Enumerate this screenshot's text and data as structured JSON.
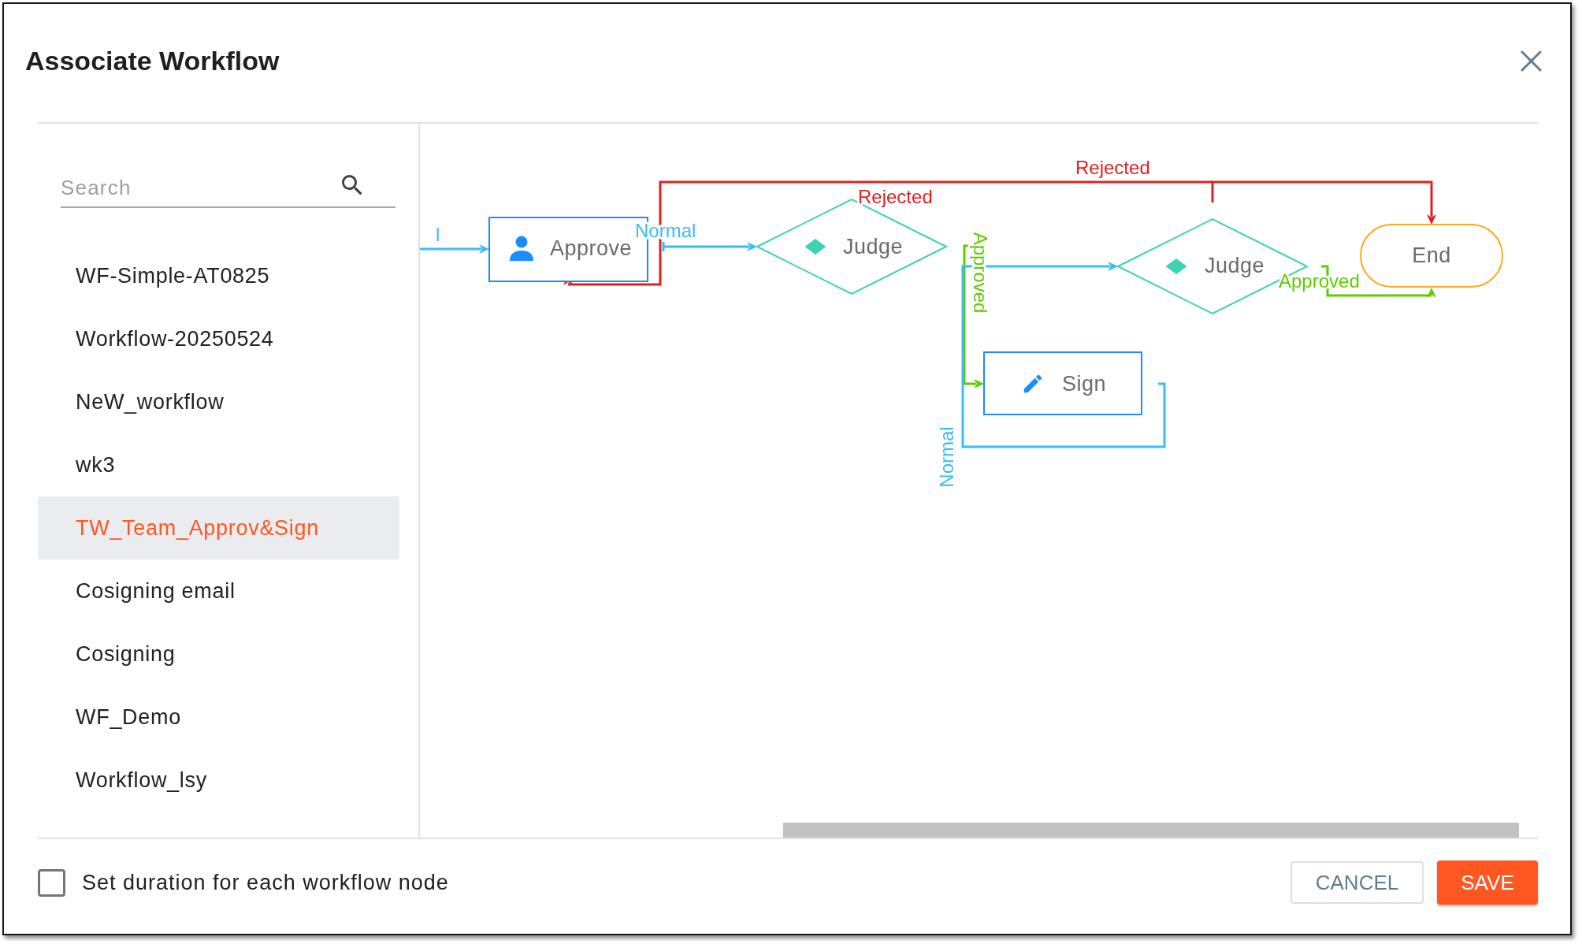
{
  "dialog": {
    "title": "Associate Workflow"
  },
  "search": {
    "placeholder": "Search"
  },
  "workflows": [
    {
      "name": "WF-Simple-AT0825",
      "selected": false
    },
    {
      "name": "Workflow-20250524",
      "selected": false
    },
    {
      "name": "NeW_workflow",
      "selected": false
    },
    {
      "name": "wk3",
      "selected": false
    },
    {
      "name": "TW_Team_Approv&Sign",
      "selected": true
    },
    {
      "name": "Cosigning email",
      "selected": false
    },
    {
      "name": "Cosigning",
      "selected": false
    },
    {
      "name": "WF_Demo",
      "selected": false
    },
    {
      "name": "Workflow_lsy",
      "selected": false
    }
  ],
  "diagram": {
    "nodes": [
      {
        "kind": "approval",
        "label": "Approve"
      },
      {
        "kind": "decision",
        "label": "Judge"
      },
      {
        "kind": "decision",
        "label": "Judge"
      },
      {
        "kind": "end",
        "label": "End"
      },
      {
        "kind": "signature",
        "label": "Sign"
      }
    ],
    "edges": [
      {
        "label": "Rejected",
        "color": "#e0201f"
      },
      {
        "label": "Rejected",
        "color": "#e0201f"
      },
      {
        "label": "l",
        "color": "#36bdfa"
      },
      {
        "label": "Normal",
        "color": "#36bdfa"
      },
      {
        "label": "Approved",
        "color": "#5fcc00"
      },
      {
        "label": "Approved",
        "color": "#5fcc00"
      },
      {
        "label": "Normal",
        "color": "#36bdfa"
      }
    ]
  },
  "footer": {
    "duration_checkbox": {
      "label": "Set duration for each workflow node",
      "checked": false
    },
    "buttons": [
      {
        "label": "CANCEL",
        "kind": "secondary"
      },
      {
        "label": "SAVE",
        "kind": "primary"
      }
    ]
  }
}
